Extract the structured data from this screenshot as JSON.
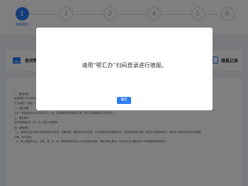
{
  "steps": [
    {
      "num": "1",
      "label": "填报须知",
      "active": true
    },
    {
      "num": "2",
      "label": "",
      "active": false
    },
    {
      "num": "3",
      "label": "",
      "active": false
    },
    {
      "num": "4",
      "label": "",
      "active": false
    },
    {
      "num": "5",
      "label": "",
      "active": false
    },
    {
      "num": "6",
      "label": "",
      "active": false
    }
  ],
  "entries": {
    "left_label": "使用鄂",
    "right_label": "填报记录"
  },
  "doc": {
    "title": "",
    "paragraphs": [
      "一、报名时间",
      "填报填报 2025年8月4日08时—8月5日18时。超出规定时间不再受理，请按时填报。",
      "正式填报：主城区（含洪区、蔡甸区、经开区）于2025年8月20—22日，其他县（市、区）于2025年8月11日—15日。",
      "二、招生对象",
      "小学一年级招收2025年8月31日（含）前年满6周岁的适龄儿童，初中七年级招收小学毕业生。",
      "三、报名条件",
      "参考所属辖区县（市、区）招生方案要求。",
      "四、填报须知",
      "（1）请您务必在开放时间内登录进行学位、学籍查询，请核实孩子的信息，不在规定时间内填报信息，视为放弃报名资格，招生将不能顺序进行，请务必于规定时间内完成填报。",
      "户籍、房产信息。",
      "（2）网上填报成功后，学校、县（市、区）教育局将对学生入学信息进行审核，请家长耐心等待，也可在平台“填报记录”中查看审核进展情况。"
    ]
  },
  "modal": {
    "message": "请用“鄂汇办”扫码登录进行填报。",
    "ok_label": "确定"
  }
}
